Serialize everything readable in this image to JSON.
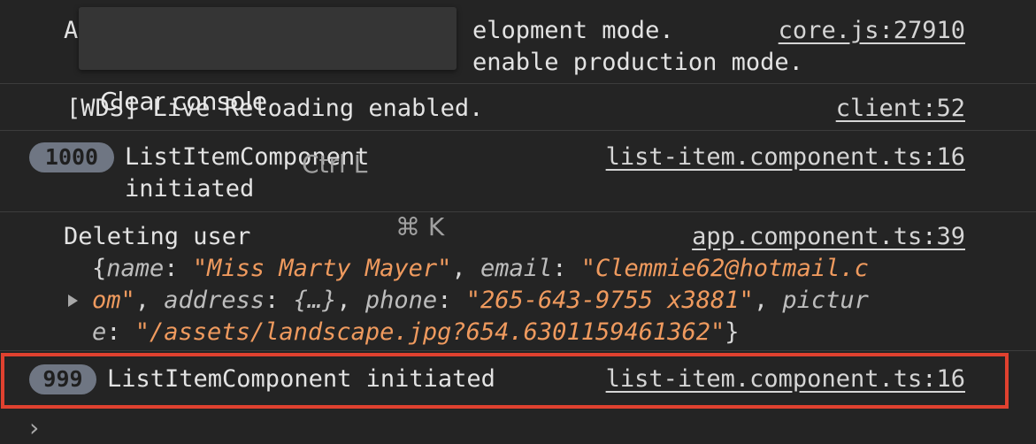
{
  "tooltip": {
    "label": "Clear console",
    "shortcut_win": "Ctrl L",
    "shortcut_mac": "⌘ K"
  },
  "messages": {
    "m1": {
      "line1_prefix": "A",
      "line1_tail": "elopment mode.",
      "line2_tail": "enable production mode.",
      "source": "core.js:27910"
    },
    "m2": {
      "text": "[WDS] Live Reloading enabled.",
      "source": "client:52"
    },
    "m3": {
      "count": "1000",
      "line1": "ListItemComponent",
      "line2": "initiated",
      "source": "list-item.component.ts:16"
    },
    "m4": {
      "text": "Deleting user",
      "source": "app.component.ts:39",
      "obj": {
        "k_name": "name",
        "v_name": "\"Miss Marty Mayer\"",
        "k_email": "email",
        "v_email_a": "\"Clemmie62@hotmail.c",
        "v_email_b": "om\"",
        "k_address": "address",
        "v_address": "{…}",
        "k_phone": "phone",
        "v_phone": "\"265-643-9755 x3881\"",
        "k_picture_a": "pictur",
        "k_picture_b": "e",
        "v_picture": "\"/assets/landscape.jpg?654.6301159461362\""
      }
    },
    "m5": {
      "count": "999",
      "text": "ListItemComponent initiated",
      "source": "list-item.component.ts:16"
    }
  },
  "prompt": "›",
  "colors": {
    "highlight": "#e0412f",
    "string": "#ef9a5e",
    "badge": "#6f7683",
    "background": "#242424"
  }
}
